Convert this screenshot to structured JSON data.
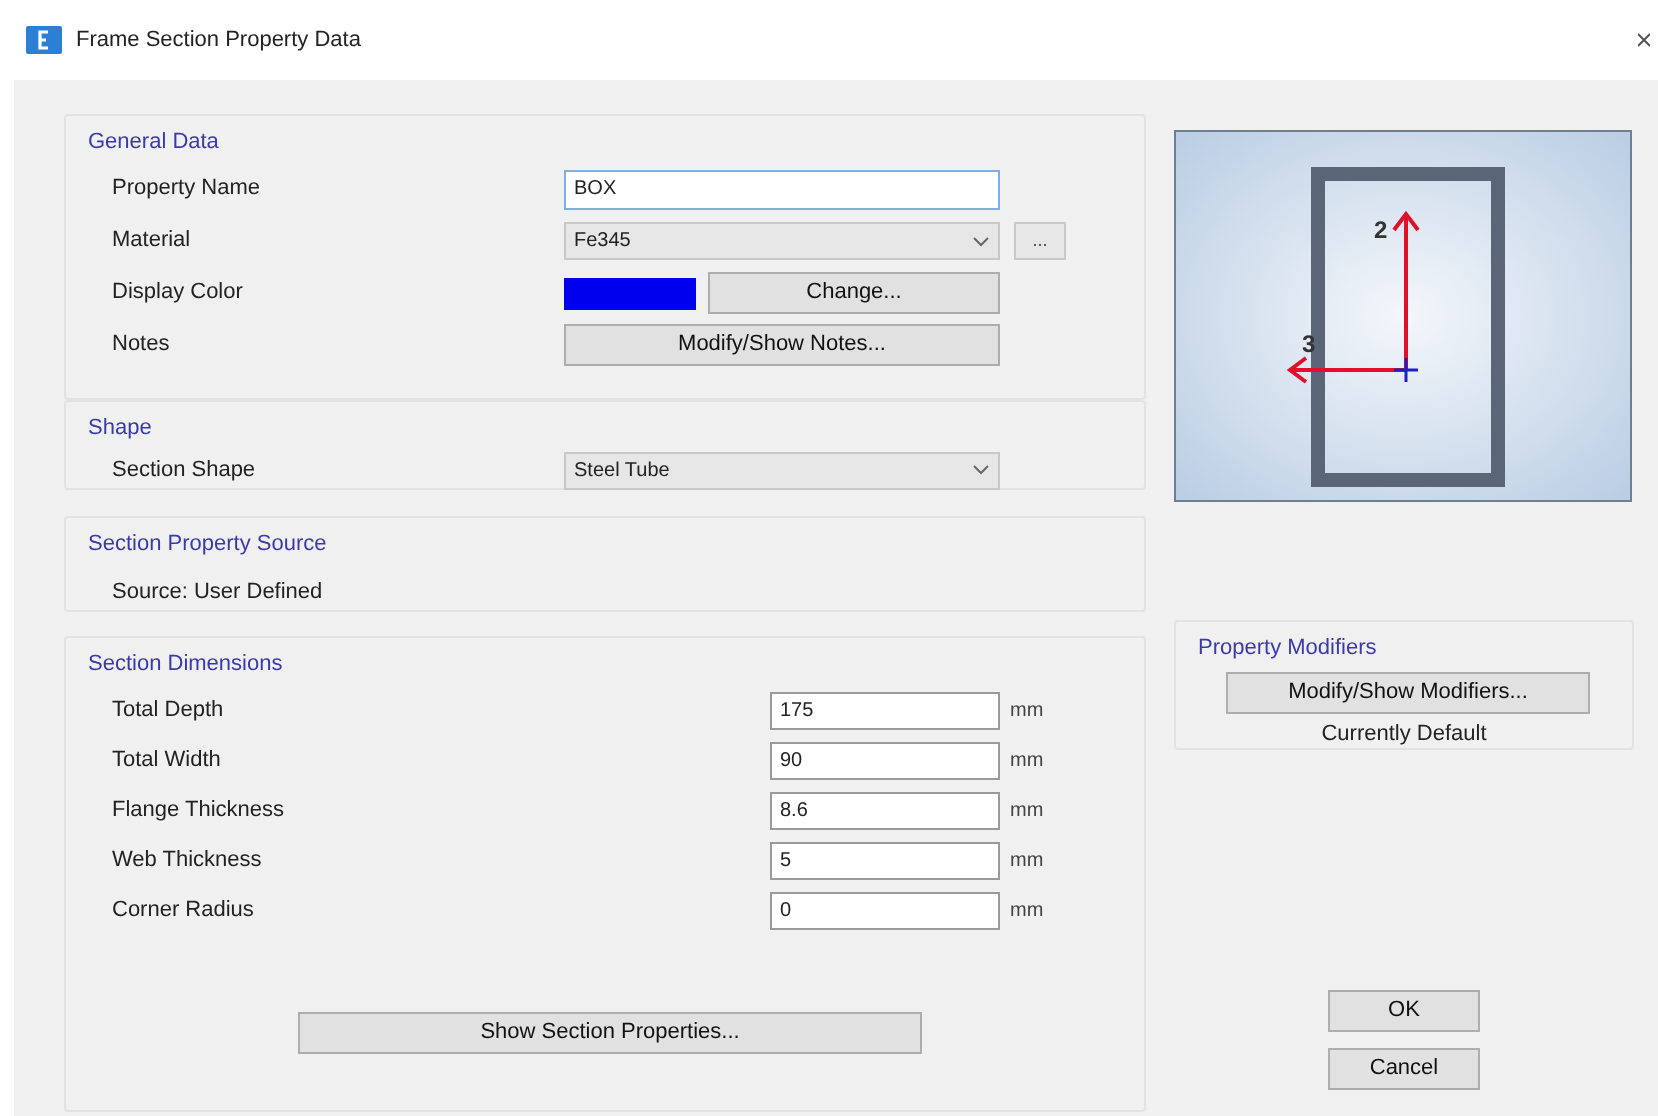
{
  "window": {
    "title": "Frame Section Property Data"
  },
  "general_data": {
    "heading": "General Data",
    "property_name": {
      "label": "Property Name",
      "value": "BOX"
    },
    "material": {
      "label": "Material",
      "value": "Fe345",
      "browse": "..."
    },
    "display_color": {
      "label": "Display Color",
      "color": "#0000ee",
      "button": "Change..."
    },
    "notes": {
      "label": "Notes",
      "button": "Modify/Show Notes..."
    }
  },
  "shape": {
    "heading": "Shape",
    "label": "Section Shape",
    "value": "Steel Tube"
  },
  "source": {
    "heading": "Section Property Source",
    "text": "Source:  User Defined"
  },
  "dimensions": {
    "heading": "Section Dimensions",
    "rows": [
      {
        "label": "Total Depth",
        "value": "175",
        "unit": "mm"
      },
      {
        "label": "Total Width",
        "value": "90",
        "unit": "mm"
      },
      {
        "label": "Flange Thickness",
        "value": "8.6",
        "unit": "mm"
      },
      {
        "label": "Web Thickness",
        "value": "5",
        "unit": "mm"
      },
      {
        "label": "Corner Radius",
        "value": "0",
        "unit": "mm"
      }
    ],
    "button": "Show Section Properties..."
  },
  "preview": {
    "axis_vertical": "2",
    "axis_horizontal": "3"
  },
  "property_modifiers": {
    "heading": "Property Modifiers",
    "button": "Modify/Show Modifiers...",
    "status": "Currently Default"
  },
  "buttons": [
    "OK",
    "Cancel"
  ]
}
